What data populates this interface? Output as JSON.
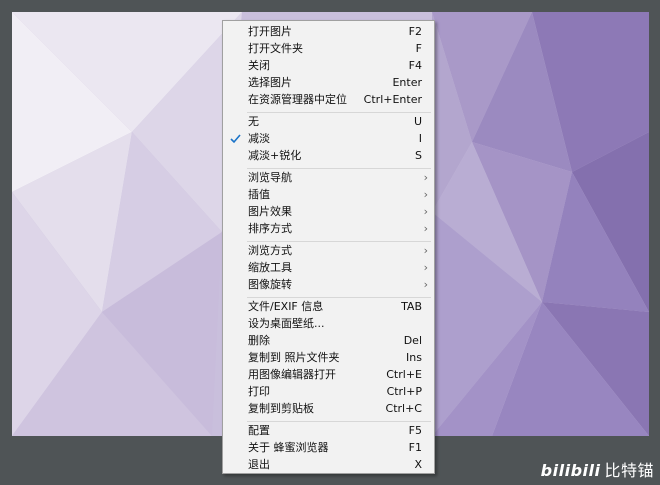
{
  "colors": {
    "window_bg": "#4f5456",
    "menu_bg": "#f2f2f2",
    "check_color": "#1a73c8"
  },
  "menu": {
    "groups": [
      [
        {
          "label": "打开图片",
          "shortcut": "F2"
        },
        {
          "label": "打开文件夹",
          "shortcut": "F"
        },
        {
          "label": "关闭",
          "shortcut": "F4"
        },
        {
          "label": "选择图片",
          "shortcut": "Enter"
        },
        {
          "label": "在资源管理器中定位",
          "shortcut": "Ctrl+Enter"
        }
      ],
      [
        {
          "label": "无",
          "shortcut": "U"
        },
        {
          "label": "减淡",
          "shortcut": "I",
          "checked": true
        },
        {
          "label": "减淡+锐化",
          "shortcut": "S"
        }
      ],
      [
        {
          "label": "浏览导航",
          "submenu": true
        },
        {
          "label": "插值",
          "submenu": true
        },
        {
          "label": "图片效果",
          "submenu": true
        },
        {
          "label": "排序方式",
          "submenu": true
        }
      ],
      [
        {
          "label": "浏览方式",
          "submenu": true
        },
        {
          "label": "缩放工具",
          "submenu": true
        },
        {
          "label": "图像旋转",
          "submenu": true
        }
      ],
      [
        {
          "label": "文件/EXIF 信息",
          "shortcut": "TAB"
        },
        {
          "label": "设为桌面壁纸..."
        },
        {
          "label": "删除",
          "shortcut": "Del"
        },
        {
          "label": "复制到 照片文件夹",
          "shortcut": "Ins"
        },
        {
          "label": "用图像编辑器打开",
          "shortcut": "Ctrl+E"
        },
        {
          "label": "打印",
          "shortcut": "Ctrl+P"
        },
        {
          "label": "复制到剪贴板",
          "shortcut": "Ctrl+C"
        }
      ],
      [
        {
          "label": "配置",
          "shortcut": "F5"
        },
        {
          "label": "关于 蜂蜜浏览器",
          "shortcut": "F1"
        },
        {
          "label": "退出",
          "shortcut": "X"
        }
      ]
    ]
  },
  "watermark": {
    "logo": "bilibili",
    "text": "比特锚"
  }
}
